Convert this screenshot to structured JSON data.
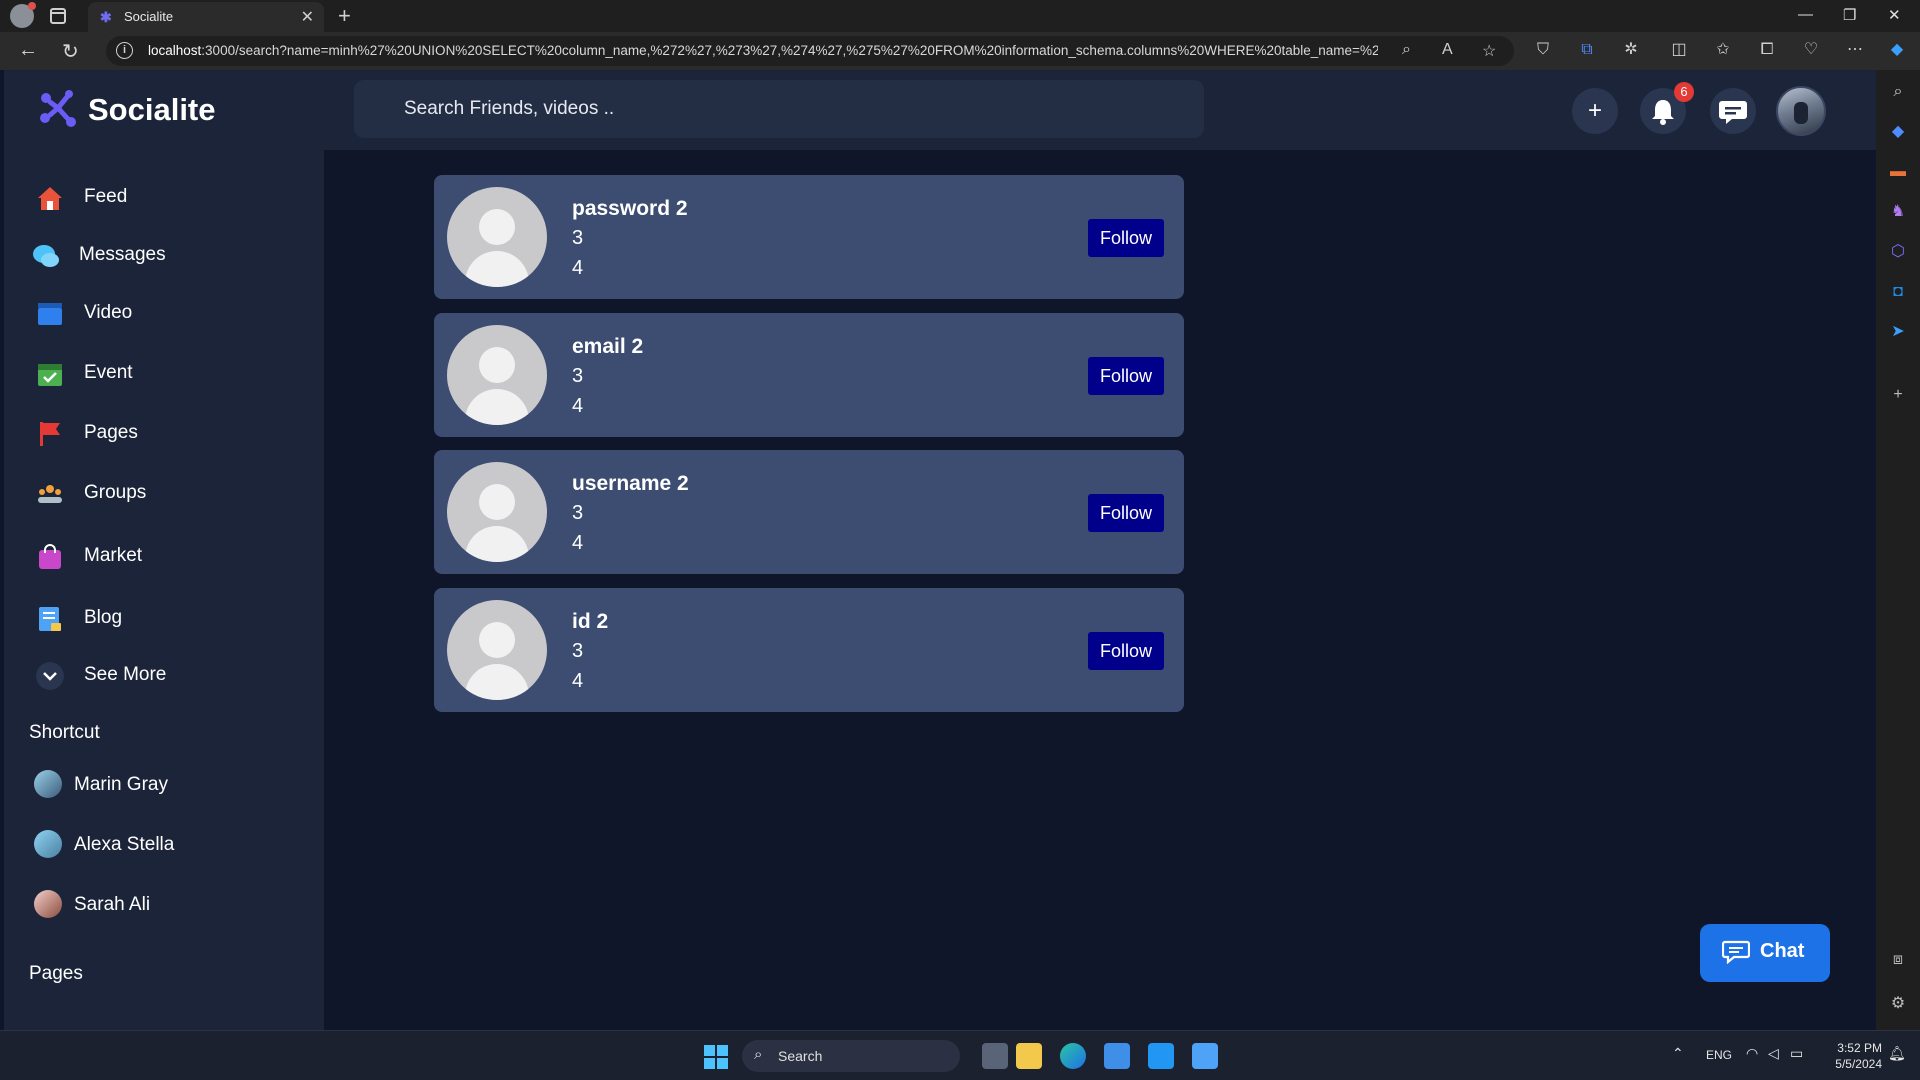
{
  "browser": {
    "tab_title": "Socialite",
    "url_host": "localhost",
    "url_rest": ":3000/search?name=minh%27%20UNION%20SELECT%20column_name,%272%27,%273%27,%274%27,%275%27%20FROM%20information_schema.columns%20WHERE%20table_name=%27..."
  },
  "header": {
    "brand": "Socialite",
    "search_placeholder": "Search Friends, videos ..",
    "notification_count": "6"
  },
  "sidebar": {
    "items": [
      {
        "label": "Feed",
        "icon": "home-icon",
        "color": "#e8533a"
      },
      {
        "label": "Messages",
        "icon": "messages-icon",
        "color": "#4fc3f7"
      },
      {
        "label": "Video",
        "icon": "video-icon",
        "color": "#2f80ed"
      },
      {
        "label": "Event",
        "icon": "calendar-icon",
        "color": "#4caf50"
      },
      {
        "label": "Pages",
        "icon": "flag-icon",
        "color": "#e53935"
      },
      {
        "label": "Groups",
        "icon": "groups-icon",
        "color": "#f2a03d"
      },
      {
        "label": "Market",
        "icon": "shopping-bag-icon",
        "color": "#c948c9"
      },
      {
        "label": "Blog",
        "icon": "blog-icon",
        "color": "#4fa3f7"
      },
      {
        "label": "See More",
        "icon": "chevron-down-icon",
        "color": "#2a3550"
      }
    ],
    "shortcut_title": "Shortcut",
    "shortcuts": [
      {
        "name": "Marin Gray"
      },
      {
        "name": "Alexa Stella"
      },
      {
        "name": "Sarah Ali"
      }
    ],
    "pages_title": "Pages"
  },
  "results": [
    {
      "line1": "password 2",
      "line2": "3",
      "line3": "4",
      "button": "Follow"
    },
    {
      "line1": "email 2",
      "line2": "3",
      "line3": "4",
      "button": "Follow"
    },
    {
      "line1": "username 2",
      "line2": "3",
      "line3": "4",
      "button": "Follow"
    },
    {
      "line1": "id 2",
      "line2": "3",
      "line3": "4",
      "button": "Follow"
    }
  ],
  "chat_button": "Chat",
  "taskbar": {
    "search_label": "Search",
    "language": "ENG",
    "time": "3:52 PM",
    "date": "5/5/2024"
  },
  "colors": {
    "app_bg": "#0f1629",
    "panel_bg": "#1b2438",
    "card_bg": "#3c4d71",
    "follow_button": "#00008b",
    "chat_button": "#1e72e8",
    "badge": "#e53935"
  }
}
